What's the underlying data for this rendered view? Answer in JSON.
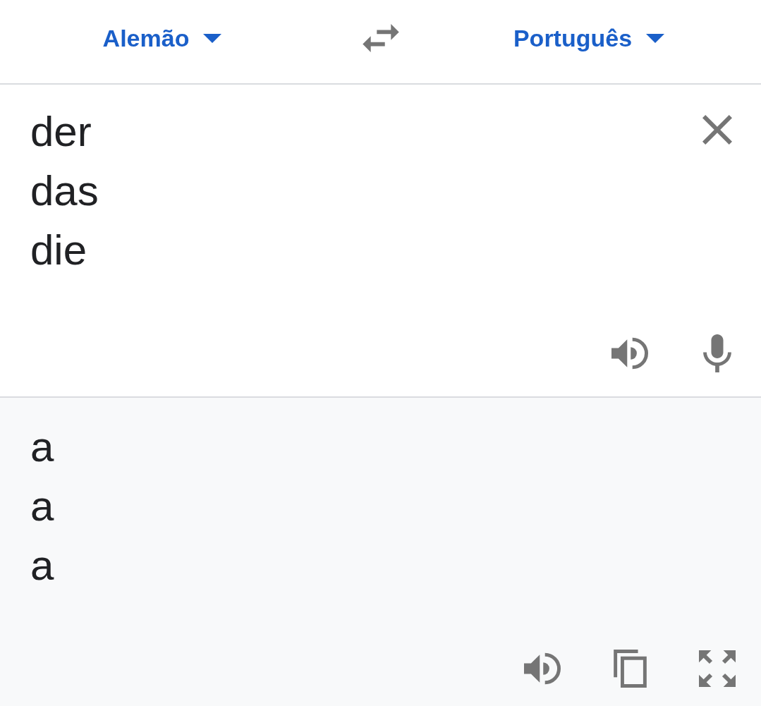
{
  "header": {
    "source_language": {
      "label": "Alemão"
    },
    "target_language": {
      "label": "Português"
    }
  },
  "input": {
    "value": "der\ndas\ndie"
  },
  "output": {
    "text": "a\na\na"
  }
}
